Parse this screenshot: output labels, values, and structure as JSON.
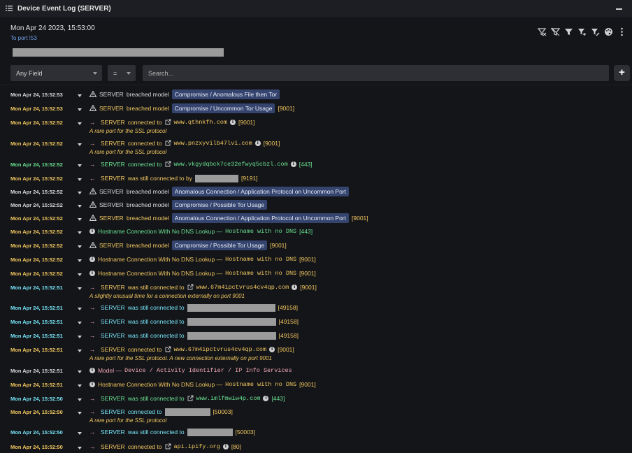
{
  "window": {
    "title": "Device Event Log (SERVER)"
  },
  "header": {
    "date": "Mon Apr 24 2023, 15:53:00",
    "port_link": "To port !53"
  },
  "filters": {
    "field": "Any Field",
    "operator": "=",
    "search_placeholder": "Search...",
    "add_label": "+"
  },
  "colors": {
    "breach": "#f1c75f",
    "connection": "#69e08f",
    "still_connected": "#75e3f5",
    "model": "#f0a9b4",
    "badge": "#34446e"
  },
  "icons": [
    "menu-icon",
    "minimize-icon",
    "filter-icons",
    "warning-icon",
    "external-link-icon",
    "info-icon",
    "chevron-down-icon",
    "arrow-right-icon",
    "arrow-left-icon"
  ],
  "rows": [
    {
      "ts": "Mon Apr 24, 15:52:53",
      "kind": "breach",
      "device": "SERVER",
      "verb": "breached model",
      "badge": "Compromise / Anomalous File then Tor",
      "tail": ""
    },
    {
      "ts": "Mon Apr 24, 15:52:53",
      "kind": "breach",
      "device": "SERVER",
      "verb": "breached model",
      "badge": "Compromise / Uncommon Tor Usage",
      "tail": "[9001]"
    },
    {
      "ts": "Mon Apr 24, 15:52:52",
      "kind": "conn",
      "device": "SERVER",
      "verb": "connected to",
      "host": "www.qthnkfh.com",
      "tail": "[9001]",
      "note": "A rare port for the SSL protocol"
    },
    {
      "ts": "Mon Apr 24, 15:52:52",
      "kind": "conn",
      "device": "SERVER",
      "verb": "connected to",
      "host": "www.pnzxyvilb47lvi.com",
      "tail": "[9001]",
      "note": "A rare port for the SSL protocol"
    },
    {
      "ts": "Mon Apr 24, 15:52:52",
      "kind": "conn",
      "device": "SERVER",
      "verb": "connected to",
      "host": "www.vkgydqbck7ce32efwyq5cbzl.com",
      "tail": "[443]"
    },
    {
      "ts": "Mon Apr 24, 15:52:52",
      "kind": "inbound",
      "device": "SERVER",
      "verb": "was still connected to by",
      "tail": "[9191]"
    },
    {
      "ts": "Mon Apr 24, 15:52:52",
      "kind": "breach",
      "device": "SERVER",
      "verb": "breached model",
      "badge": "Anomalous Connection / Application Protocol on Uncommon Port",
      "tail": ""
    },
    {
      "ts": "Mon Apr 24, 15:52:52",
      "kind": "breach",
      "device": "SERVER",
      "verb": "breached model",
      "badge": "Compromise / Possible Tor Usage",
      "tail": ""
    },
    {
      "ts": "Mon Apr 24, 15:52:52",
      "kind": "breach",
      "device": "SERVER",
      "verb": "breached model",
      "badge": "Anomalous Connection / Application Protocol on Uncommon Port",
      "tail": "[9001]"
    },
    {
      "ts": "Mon Apr 24, 15:52:52",
      "kind": "hostname",
      "text": "Hostname Connection With No DNS Lookup —",
      "mono": "Hostname with no DNS",
      "tail": "[443]"
    },
    {
      "ts": "Mon Apr 24, 15:52:52",
      "kind": "breach",
      "device": "SERVER",
      "verb": "breached model",
      "badge": "Compromise / Possible Tor Usage",
      "tail": "[9001]"
    },
    {
      "ts": "Mon Apr 24, 15:52:52",
      "kind": "hostname",
      "text": "Hostname Connection With No DNS Lookup —",
      "mono": "Hostname with no DNS",
      "tail": "[9001]"
    },
    {
      "ts": "Mon Apr 24, 15:52:52",
      "kind": "hostname",
      "text": "Hostname Connection With No DNS Lookup —",
      "mono": "Hostname with no DNS",
      "tail": "[9001]"
    },
    {
      "ts": "Mon Apr 24, 15:52:51",
      "kind": "still",
      "device": "SERVER",
      "verb": "was still connected to",
      "host": "www.67m4ipctvrus4cv4qp.com",
      "tail": "[9001]",
      "note": "A slightly unusual time for a connection externally on port 9001"
    },
    {
      "ts": "Mon Apr 24, 15:52:51",
      "kind": "still_red",
      "device": "SERVER",
      "verb": "was still connected to",
      "tail": "[49158]"
    },
    {
      "ts": "Mon Apr 24, 15:52:51",
      "kind": "still_red",
      "device": "SERVER",
      "verb": "was still connected to",
      "tail": "[49158]"
    },
    {
      "ts": "Mon Apr 24, 15:52:51",
      "kind": "still_red",
      "device": "SERVER",
      "verb": "was still connected to",
      "tail": "[49158]"
    },
    {
      "ts": "Mon Apr 24, 15:52:51",
      "kind": "conn",
      "device": "SERVER",
      "verb": "connected to",
      "host": "www.67m4ipctvrus4cv4qp.com",
      "tail": "[9001]",
      "note": "A rare port for the SSL protocol. A new connection externally on port 9001"
    },
    {
      "ts": "Mon Apr 24, 15:52:51",
      "kind": "model",
      "text": "Model —",
      "mono": "Device / Activity Identifier / IP Info Services"
    },
    {
      "ts": "Mon Apr 24, 15:52:51",
      "kind": "hostname",
      "text": "Hostname Connection With No DNS Lookup —",
      "mono": "Hostname with no DNS",
      "tail": "[9001]"
    },
    {
      "ts": "Mon Apr 24, 15:52:50",
      "kind": "still",
      "device": "SERVER",
      "verb": "was still connected to",
      "host": "www.imlfmwiw4p.com",
      "tail": "[443]"
    },
    {
      "ts": "Mon Apr 24, 15:52:50",
      "kind": "conn_red",
      "device": "SERVER",
      "verb": "connected to",
      "tail": "[50003]",
      "note": "A rare port for the SSL protocol"
    },
    {
      "ts": "Mon Apr 24, 15:52:50",
      "kind": "still_red",
      "device": "SERVER",
      "verb": "was still connected to",
      "tail": "[50003]"
    },
    {
      "ts": "Mon Apr 24, 15:52:50",
      "kind": "conn",
      "device": "SERVER",
      "verb": "connected to",
      "host": "api.ipify.org",
      "tail": "[80]"
    }
  ]
}
